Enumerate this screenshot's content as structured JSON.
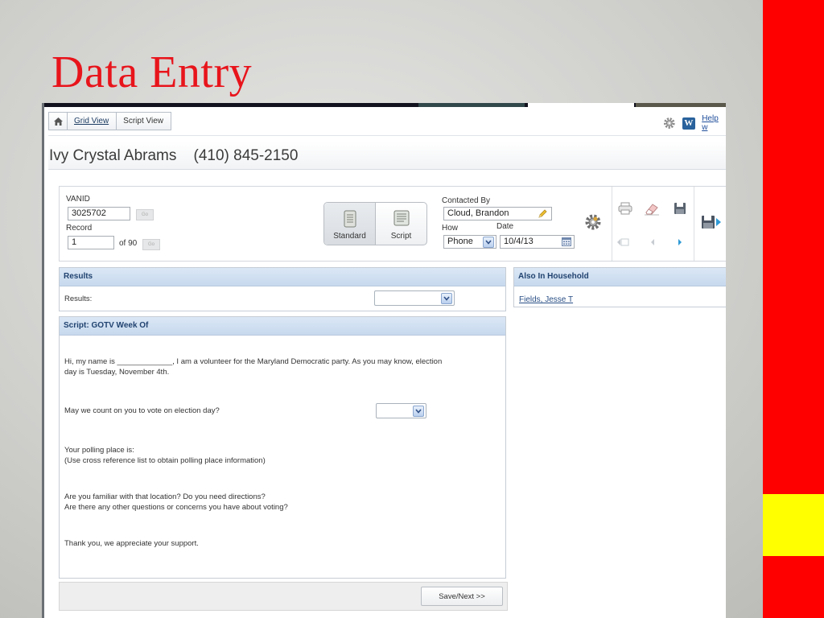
{
  "slide": {
    "title": "Data Entry"
  },
  "breadcrumb": {
    "grid_view": "Grid View",
    "script_view": "Script View"
  },
  "help": {
    "w_letter": "W",
    "label": "Help w"
  },
  "contact": {
    "name": "Ivy Crystal Abrams",
    "phone": "(410) 845-2150"
  },
  "controls": {
    "vanid_label": "VANID",
    "vanid_value": "3025702",
    "go_label": "Go",
    "record_label": "Record",
    "record_value": "1",
    "record_of": "of 90",
    "view_standard": "Standard",
    "view_script": "Script",
    "contacted_by_label": "Contacted By",
    "contacted_by_value": "Cloud, Brandon",
    "how_label": "How",
    "how_value": "Phone",
    "date_label": "Date",
    "date_value": "10/4/13"
  },
  "results_panel": {
    "heading": "Results",
    "results_label": "Results:",
    "results_value": ""
  },
  "household_panel": {
    "heading": "Also In Household",
    "members": [
      "Fields, Jesse T"
    ]
  },
  "script_panel": {
    "heading": "Script: GOTV Week Of",
    "intro_line1": "Hi, my name is _____________, I am a volunteer for the Maryland Democratic party. As you may know, election",
    "intro_line2": "day is Tuesday, November 4th.",
    "question": "May we count on you to vote on election day?",
    "question_value": "",
    "polling_line1": "Your polling place is:",
    "polling_line2": "(Use cross reference list to obtain polling place information)",
    "familiar_line1": "Are you familiar with that location? Do you need directions?",
    "familiar_line2": "Are there any other questions or concerns you have about voting?",
    "thanks": "Thank you, we appreciate your support."
  },
  "footer": {
    "save_next": "Save/Next >>"
  }
}
